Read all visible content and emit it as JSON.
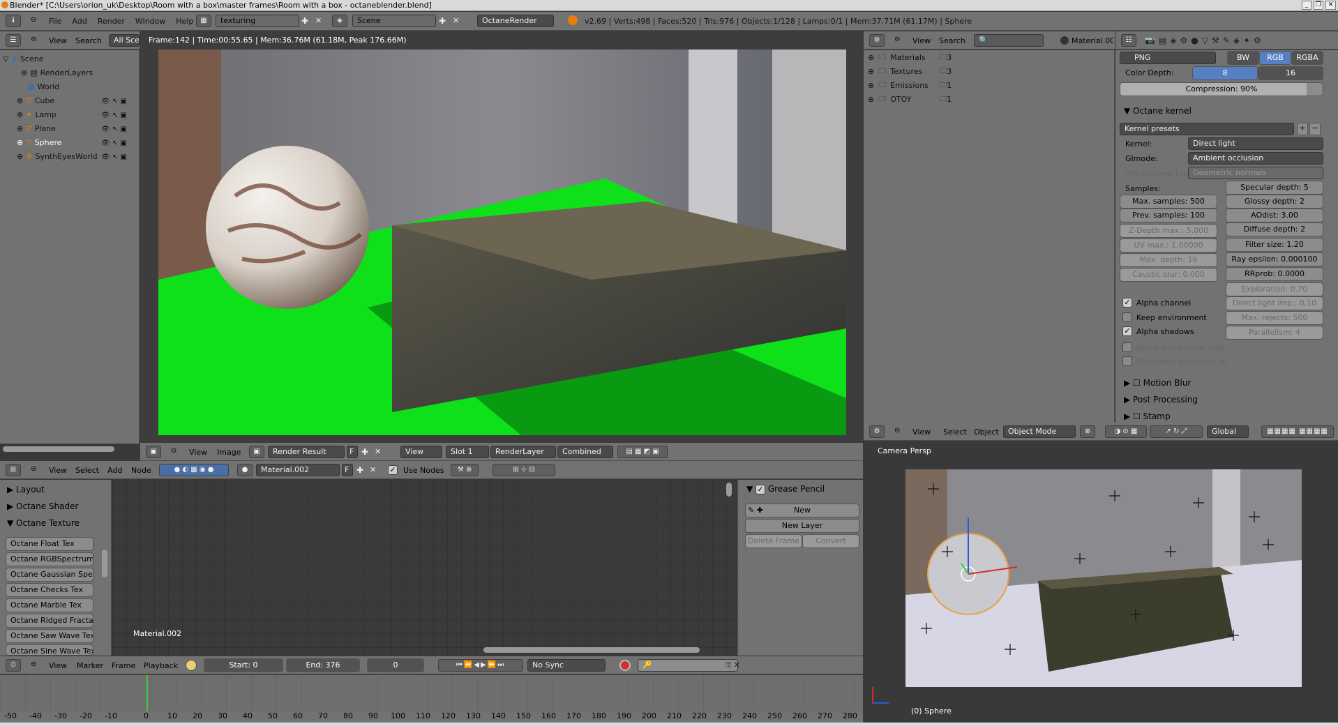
{
  "window": {
    "title": "Blender* [C:\\Users\\orion_uk\\Desktop\\Room with a box\\master frames\\Room with a box - octaneblender.blend]"
  },
  "info_bar": {
    "menus": [
      "File",
      "Add",
      "Render",
      "Window",
      "Help"
    ],
    "screen": "texturing",
    "scene": "Scene",
    "engine": "OctaneRender",
    "stats": "v2.69 | Verts:498 | Faces:520 | Tris:976 | Objects:1/128 | Lamps:0/1 | Mem:37.71M (61.17M) | Sphere"
  },
  "outliner": {
    "menus": [
      "View",
      "Search"
    ],
    "display_mode": "All Sce",
    "items": [
      "Scene",
      "RenderLayers",
      "World",
      "Cube",
      "Lamp",
      "Plane",
      "Sphere",
      "SynthEyesWorld"
    ]
  },
  "image_editor": {
    "render_info": "Frame:142 | Time:00:55.65 | Mem:36.76M (61.18M, Peak 176.66M)",
    "menus": [
      "View",
      "Image"
    ],
    "image_name": "Render Result",
    "f_label": "F",
    "view_label": "View",
    "slot": "Slot 1",
    "layer": "RenderLayer",
    "pass": "Combined"
  },
  "browser": {
    "menus": [
      "View",
      "Search"
    ],
    "material": "Material.00",
    "items": [
      {
        "name": "Materials",
        "count": "3"
      },
      {
        "name": "Textures",
        "count": "3"
      },
      {
        "name": "Emissions",
        "count": "1"
      },
      {
        "name": "OTOY",
        "count": "1"
      }
    ]
  },
  "properties": {
    "format": "PNG",
    "color_modes": [
      "BW",
      "RGB",
      "RGBA"
    ],
    "color_depth_label": "Color Depth:",
    "depth_8": "8",
    "depth_16": "16",
    "compression": "Compression: 90%",
    "kernel_panel": "Octane kernel",
    "kernel_presets": "Kernel presets",
    "kernel_label": "Kernel:",
    "kernel_value": "Direct light",
    "gimode_label": "GImode:",
    "gimode_value": "Ambient occlusion",
    "info_label": "Info-channel type:",
    "info_value": "Geometric normals",
    "samples_label": "Samples:",
    "left_fields": [
      "Max. samples: 500",
      "Prev. samples: 100",
      "Z-Depth max.: 5.000",
      "UV max.: 1.00000",
      "Max. depth: 16",
      "Caustic blur: 0.000"
    ],
    "right_fields": [
      "Specular depth: 5",
      "Glossy depth: 2",
      "AOdist: 3.00",
      "Diffuse depth: 2",
      "Filter size: 1.20",
      "Ray epsilon: 0.000100",
      "RRprob: 0.0000",
      "Exploration: 0.70",
      "Direct light imp.: 0.10",
      "Max. rejects: 500",
      "Parallelism: 4"
    ],
    "checks": [
      "Alpha channel",
      "Keep environment",
      "Alpha shadows",
      "Bump and normal map",
      "Wireframe backtrace hi"
    ],
    "panels": [
      "Motion Blur",
      "Post Processing",
      "Stamp"
    ]
  },
  "node_editor": {
    "menus": [
      "View",
      "Select",
      "Add",
      "Node"
    ],
    "material": "Material.002",
    "f_label": "F",
    "use_nodes": "Use Nodes",
    "canvas_label": "Material.002",
    "sections": [
      "Layout",
      "Octane Shader",
      "Octane Texture"
    ],
    "tex_buttons": [
      "Octane Float Tex",
      "Octane RGBSpectrum T",
      "Octane Gaussian Spectr",
      "Octane Checks Tex",
      "Octane Marble Tex",
      "Octane Ridged Fractal",
      "Octane Saw Wave Tex",
      "Octane Sine Wave Tex"
    ]
  },
  "grease": {
    "title": "Grease Pencil",
    "new": "New",
    "new_layer": "New Layer",
    "delete_frame": "Delete Frame",
    "convert": "Convert"
  },
  "view3d": {
    "menus": [
      "View",
      "Select",
      "Object"
    ],
    "mode": "Object Mode",
    "orientation": "Global",
    "label": "Camera Persp",
    "object_label": "(0) Sphere"
  },
  "timeline": {
    "menus": [
      "View",
      "Marker",
      "Frame",
      "Playback"
    ],
    "start": "Start: 0",
    "end": "End: 376",
    "current": "0",
    "sync": "No Sync",
    "ticks": [
      "-50",
      "-40",
      "-30",
      "-20",
      "-10",
      "0",
      "10",
      "20",
      "30",
      "40",
      "50",
      "60",
      "70",
      "80",
      "90",
      "100",
      "110",
      "120",
      "130",
      "140",
      "150",
      "160",
      "170",
      "180",
      "190",
      "200",
      "210",
      "220",
      "230",
      "240",
      "250",
      "260",
      "270",
      "280"
    ]
  }
}
